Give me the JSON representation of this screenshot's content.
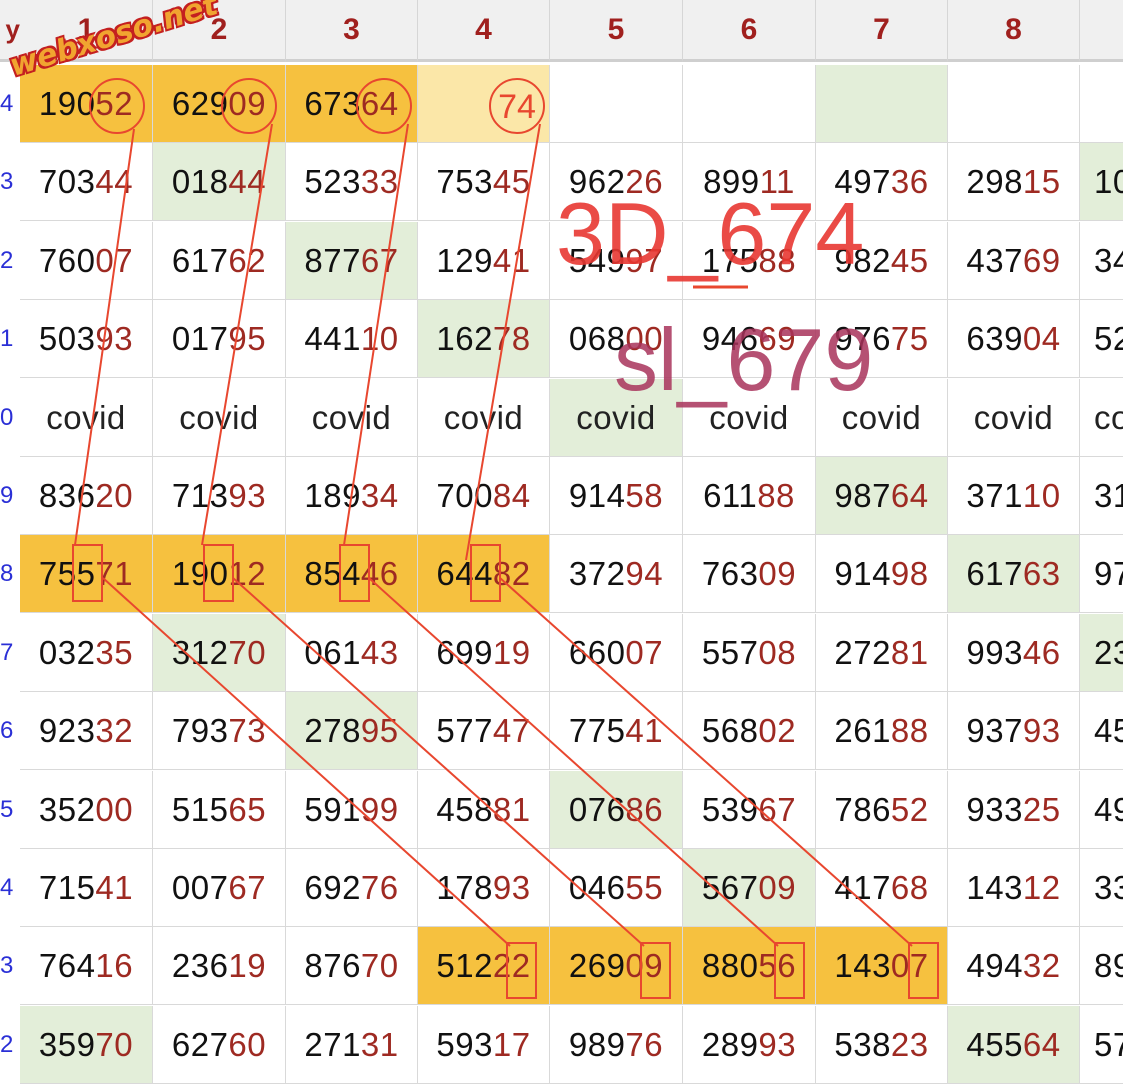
{
  "site_watermark": "webxoso.net",
  "corner_label": "y",
  "columns": [
    "1",
    "2",
    "3",
    "4",
    "5",
    "6",
    "7",
    "8",
    ""
  ],
  "row_labels": [
    "4",
    "3",
    "2",
    "1",
    "0",
    "9",
    "8",
    "7",
    "6",
    "5",
    "4",
    "3",
    "2"
  ],
  "rows": [
    [
      {
        "a": "190",
        "b": "52",
        "bg": "orange"
      },
      {
        "a": "629",
        "b": "09",
        "bg": "orange"
      },
      {
        "a": "673",
        "b": "64",
        "bg": "orange"
      },
      {
        "a": "",
        "b": "",
        "bg": "pale"
      },
      {
        "a": "",
        "b": "",
        "bg": ""
      },
      {
        "a": "",
        "b": "",
        "bg": ""
      },
      {
        "a": "",
        "b": "",
        "bg": "green"
      },
      {
        "a": "",
        "b": "",
        "bg": ""
      },
      {
        "a": "",
        "b": "",
        "bg": ""
      }
    ],
    [
      {
        "a": "703",
        "b": "44",
        "bg": ""
      },
      {
        "a": "018",
        "b": "44",
        "bg": "green"
      },
      {
        "a": "523",
        "b": "33",
        "bg": ""
      },
      {
        "a": "753",
        "b": "45",
        "bg": ""
      },
      {
        "a": "962",
        "b": "26",
        "bg": ""
      },
      {
        "a": "899",
        "b": "11",
        "bg": ""
      },
      {
        "a": "497",
        "b": "36",
        "bg": ""
      },
      {
        "a": "298",
        "b": "15",
        "bg": ""
      },
      {
        "a": "10",
        "b": "",
        "bg": "green"
      }
    ],
    [
      {
        "a": "760",
        "b": "07",
        "bg": ""
      },
      {
        "a": "617",
        "b": "62",
        "bg": ""
      },
      {
        "a": "877",
        "b": "67",
        "bg": "green"
      },
      {
        "a": "129",
        "b": "41",
        "bg": ""
      },
      {
        "a": "549",
        "b": "97",
        "bg": ""
      },
      {
        "a": "175",
        "b": "88",
        "bg": ""
      },
      {
        "a": "982",
        "b": "45",
        "bg": ""
      },
      {
        "a": "437",
        "b": "69",
        "bg": ""
      },
      {
        "a": "34",
        "b": "",
        "bg": ""
      }
    ],
    [
      {
        "a": "503",
        "b": "93",
        "bg": ""
      },
      {
        "a": "017",
        "b": "95",
        "bg": ""
      },
      {
        "a": "441",
        "b": "10",
        "bg": ""
      },
      {
        "a": "162",
        "b": "78",
        "bg": "green"
      },
      {
        "a": "068",
        "b": "00",
        "bg": ""
      },
      {
        "a": "946",
        "b": "69",
        "bg": ""
      },
      {
        "a": "976",
        "b": "75",
        "bg": ""
      },
      {
        "a": "639",
        "b": "04",
        "bg": ""
      },
      {
        "a": "52",
        "b": "",
        "bg": ""
      }
    ],
    [
      {
        "w": "covid",
        "bg": ""
      },
      {
        "w": "covid",
        "bg": ""
      },
      {
        "w": "covid",
        "bg": ""
      },
      {
        "w": "covid",
        "bg": ""
      },
      {
        "w": "covid",
        "bg": "green"
      },
      {
        "w": "covid",
        "bg": ""
      },
      {
        "w": "covid",
        "bg": ""
      },
      {
        "w": "covid",
        "bg": ""
      },
      {
        "w": "co",
        "bg": ""
      }
    ],
    [
      {
        "a": "836",
        "b": "20",
        "bg": ""
      },
      {
        "a": "713",
        "b": "93",
        "bg": ""
      },
      {
        "a": "189",
        "b": "34",
        "bg": ""
      },
      {
        "a": "700",
        "b": "84",
        "bg": ""
      },
      {
        "a": "914",
        "b": "58",
        "bg": ""
      },
      {
        "a": "611",
        "b": "88",
        "bg": ""
      },
      {
        "a": "987",
        "b": "64",
        "bg": "green"
      },
      {
        "a": "371",
        "b": "10",
        "bg": ""
      },
      {
        "a": "31",
        "b": "",
        "bg": ""
      }
    ],
    [
      {
        "a": "755",
        "b": "71",
        "bg": "orange"
      },
      {
        "a": "190",
        "b": "12",
        "bg": "orange"
      },
      {
        "a": "854",
        "b": "46",
        "bg": "orange"
      },
      {
        "a": "644",
        "b": "82",
        "bg": "orange"
      },
      {
        "a": "372",
        "b": "94",
        "bg": ""
      },
      {
        "a": "763",
        "b": "09",
        "bg": ""
      },
      {
        "a": "914",
        "b": "98",
        "bg": ""
      },
      {
        "a": "617",
        "b": "63",
        "bg": "green"
      },
      {
        "a": "97",
        "b": "",
        "bg": ""
      }
    ],
    [
      {
        "a": "032",
        "b": "35",
        "bg": ""
      },
      {
        "a": "312",
        "b": "70",
        "bg": "green"
      },
      {
        "a": "061",
        "b": "43",
        "bg": ""
      },
      {
        "a": "699",
        "b": "19",
        "bg": ""
      },
      {
        "a": "660",
        "b": "07",
        "bg": ""
      },
      {
        "a": "557",
        "b": "08",
        "bg": ""
      },
      {
        "a": "272",
        "b": "81",
        "bg": ""
      },
      {
        "a": "993",
        "b": "46",
        "bg": ""
      },
      {
        "a": "23",
        "b": "",
        "bg": "green"
      }
    ],
    [
      {
        "a": "923",
        "b": "32",
        "bg": ""
      },
      {
        "a": "793",
        "b": "73",
        "bg": ""
      },
      {
        "a": "278",
        "b": "95",
        "bg": "green"
      },
      {
        "a": "577",
        "b": "47",
        "bg": ""
      },
      {
        "a": "775",
        "b": "41",
        "bg": ""
      },
      {
        "a": "568",
        "b": "02",
        "bg": ""
      },
      {
        "a": "261",
        "b": "88",
        "bg": ""
      },
      {
        "a": "937",
        "b": "93",
        "bg": ""
      },
      {
        "a": "45",
        "b": "",
        "bg": ""
      }
    ],
    [
      {
        "a": "352",
        "b": "00",
        "bg": ""
      },
      {
        "a": "515",
        "b": "65",
        "bg": ""
      },
      {
        "a": "591",
        "b": "99",
        "bg": ""
      },
      {
        "a": "458",
        "b": "81",
        "bg": ""
      },
      {
        "a": "076",
        "b": "86",
        "bg": "green"
      },
      {
        "a": "539",
        "b": "67",
        "bg": ""
      },
      {
        "a": "786",
        "b": "52",
        "bg": ""
      },
      {
        "a": "933",
        "b": "25",
        "bg": ""
      },
      {
        "a": "49",
        "b": "",
        "bg": ""
      }
    ],
    [
      {
        "a": "715",
        "b": "41",
        "bg": ""
      },
      {
        "a": "007",
        "b": "67",
        "bg": ""
      },
      {
        "a": "692",
        "b": "76",
        "bg": ""
      },
      {
        "a": "178",
        "b": "93",
        "bg": ""
      },
      {
        "a": "046",
        "b": "55",
        "bg": ""
      },
      {
        "a": "567",
        "b": "09",
        "bg": "green"
      },
      {
        "a": "417",
        "b": "68",
        "bg": ""
      },
      {
        "a": "143",
        "b": "12",
        "bg": ""
      },
      {
        "a": "33",
        "b": "",
        "bg": ""
      }
    ],
    [
      {
        "a": "764",
        "b": "16",
        "bg": ""
      },
      {
        "a": "236",
        "b": "19",
        "bg": ""
      },
      {
        "a": "876",
        "b": "70",
        "bg": ""
      },
      {
        "a": "512",
        "b": "22",
        "bg": "orange"
      },
      {
        "a": "269",
        "b": "09",
        "bg": "orange"
      },
      {
        "a": "880",
        "b": "56",
        "bg": "orange"
      },
      {
        "a": "143",
        "b": "07",
        "bg": "orange"
      },
      {
        "a": "494",
        "b": "32",
        "bg": ""
      },
      {
        "a": "89",
        "b": "",
        "bg": ""
      }
    ],
    [
      {
        "a": "359",
        "b": "70",
        "bg": "green"
      },
      {
        "a": "627",
        "b": "60",
        "bg": ""
      },
      {
        "a": "271",
        "b": "31",
        "bg": ""
      },
      {
        "a": "593",
        "b": "17",
        "bg": ""
      },
      {
        "a": "989",
        "b": "76",
        "bg": ""
      },
      {
        "a": "289",
        "b": "93",
        "bg": ""
      },
      {
        "a": "538",
        "b": "23",
        "bg": ""
      },
      {
        "a": "455",
        "b": "64",
        "bg": "green"
      },
      {
        "a": "57",
        "b": "",
        "bg": ""
      }
    ]
  ],
  "circled_text": "74",
  "annotations": {
    "line1": "3D_674",
    "line2": "sl_679"
  },
  "colors": {
    "highlight_orange": "#f6c13f",
    "highlight_green": "#e3eed9",
    "annotation_red": "#e8472f",
    "annotation_pink": "#a8325a",
    "digit_red": "#9e2a22",
    "row_label_blue": "#2a2fd6"
  }
}
